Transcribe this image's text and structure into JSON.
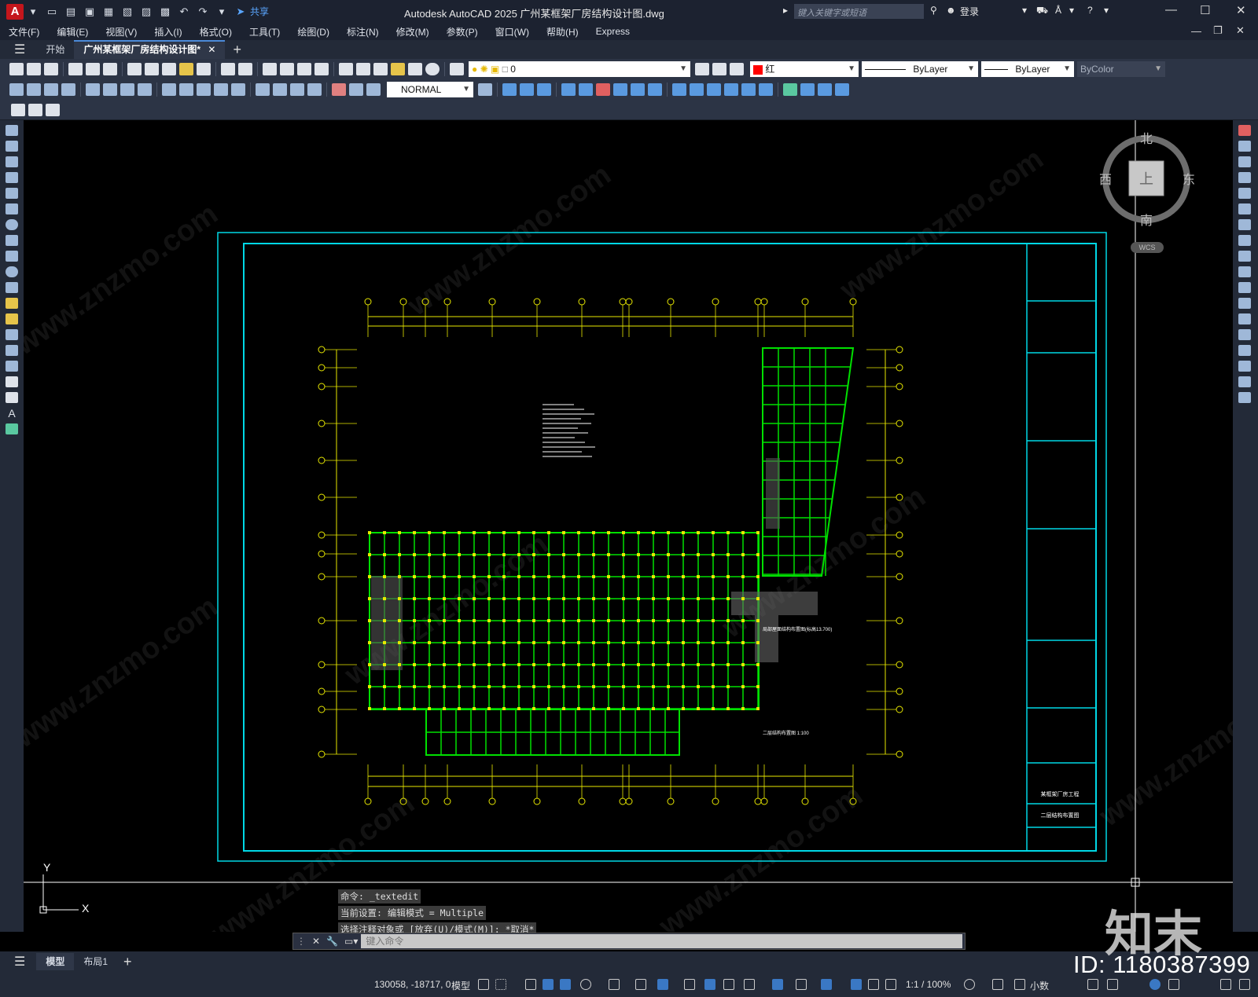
{
  "app": {
    "logo": "A",
    "title": "Autodesk AutoCAD 2025    广州某框架厂房结构设计图.dwg",
    "share_label": "共享",
    "search_placeholder": "键入关键字或短语",
    "login_label": "登录"
  },
  "menu": [
    "文件(F)",
    "编辑(E)",
    "视图(V)",
    "插入(I)",
    "格式(O)",
    "工具(T)",
    "绘图(D)",
    "标注(N)",
    "修改(M)",
    "参数(P)",
    "窗口(W)",
    "帮助(H)",
    "Express"
  ],
  "tabs": {
    "start": "开始",
    "drawing": "广州某框架厂房结构设计图*"
  },
  "ribbon": {
    "layer_value": "0",
    "color_value": "红",
    "linetype_value": "ByLayer",
    "lineweight_value": "ByLayer",
    "plotstyle_value": "ByColor",
    "dimstyle_value": "NORMAL"
  },
  "colors": {
    "accent": "#4b8ad8",
    "frame": "#00d8e6",
    "grid_green": "#00e000",
    "axis_yellow": "#e8e800",
    "red_swatch": "#ff0000"
  },
  "viewcube": {
    "north": "北",
    "south": "南",
    "east": "东",
    "west": "西",
    "top": "上",
    "wcs": "WCS"
  },
  "ucs": {
    "x": "X",
    "y": "Y"
  },
  "drawing": {
    "title_block_project": "某框架厂房工程",
    "title_block_sheet": "二层结构布置图",
    "plan_label_1": "二层结构布置图 1:100",
    "plan_label_2": "局部屋面结构布置图(标高13.700)"
  },
  "command": {
    "history": [
      "命令: _textedit",
      "当前设置: 编辑模式 = Multiple",
      "选择注释对象或 [放弃(U)/模式(M)]: *取消*"
    ],
    "placeholder": "键入命令"
  },
  "layout_tabs": [
    "模型",
    "布局1"
  ],
  "status": {
    "coords": "130058, -18717, 0",
    "model": "模型",
    "scale": "1:1 / 100%",
    "units": "小数"
  },
  "watermark": {
    "logo": "知末",
    "id": "ID: 1180387399",
    "site": "www.znzmo.com"
  }
}
